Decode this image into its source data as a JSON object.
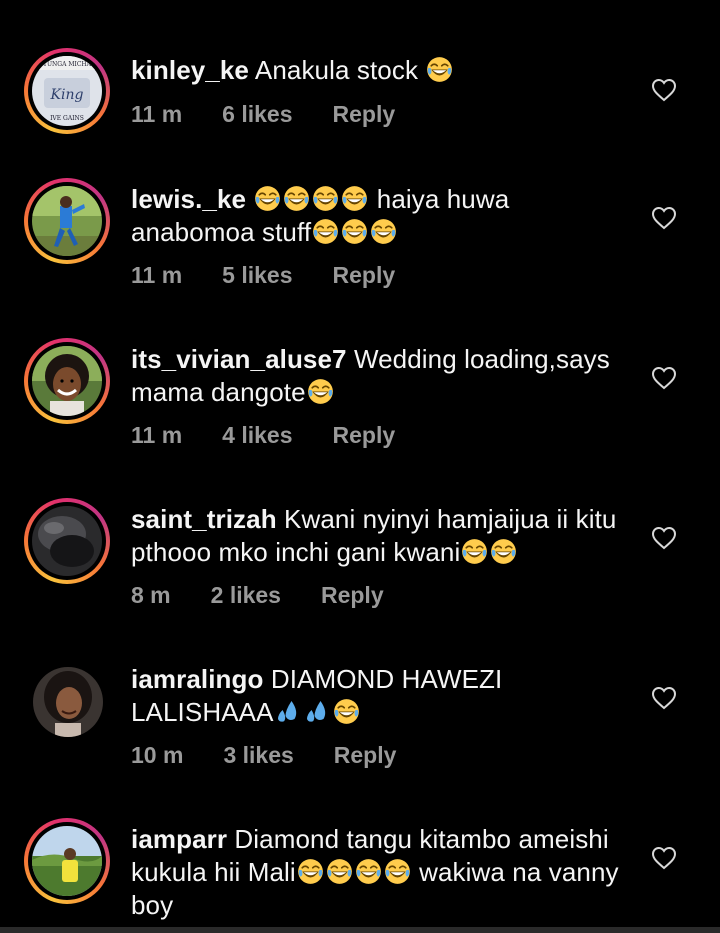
{
  "comments": [
    {
      "username": "kinley_ke",
      "text_parts": [
        "Anakula stock",
        "😂"
      ],
      "time": "11 m",
      "likes": "6 likes",
      "reply": "Reply",
      "avatar_text": [
        "TUNGA MICHA",
        "King",
        "IVE GAINS"
      ]
    },
    {
      "username": "lewis._ke",
      "text_parts": [
        "😂😂😂😂",
        "haiya huwa anabomoa stuff",
        "😂😂😂"
      ],
      "time": "11 m",
      "likes": "5 likes",
      "reply": "Reply"
    },
    {
      "username": "its_vivian_aluse7",
      "text_parts": [
        "Wedding loading,says mama dangote",
        "😂"
      ],
      "time": "11 m",
      "likes": "4 likes",
      "reply": "Reply"
    },
    {
      "username": "saint_trizah",
      "text_parts": [
        "Kwani nyinyi hamjaijua ii kitu pthooo mko inchi gani kwani",
        "😂😂"
      ],
      "time": "8 m",
      "likes": "2 likes",
      "reply": "Reply"
    },
    {
      "username": "iamralingo",
      "text_parts": [
        "DIAMOND HAWEZI LALISHAAA",
        "💦💦😂"
      ],
      "time": "10 m",
      "likes": "3 likes",
      "reply": "Reply"
    },
    {
      "username": "iamparr",
      "text_parts": [
        "Diamond tangu kitambo ameishi kukula hii Mali",
        "😂😂😂😂",
        "wakiwa na vanny boy"
      ]
    }
  ],
  "icons": {
    "like": "heart-outline-icon",
    "laugh": "face-with-tears-of-joy-emoji",
    "sweat": "sweat-droplets-emoji"
  },
  "colors": {
    "background": "#000000",
    "text": "#f5f5f5",
    "meta": "#9a9a9a",
    "story_ring_start": "#f9c23c",
    "story_ring_end": "#c13584"
  }
}
